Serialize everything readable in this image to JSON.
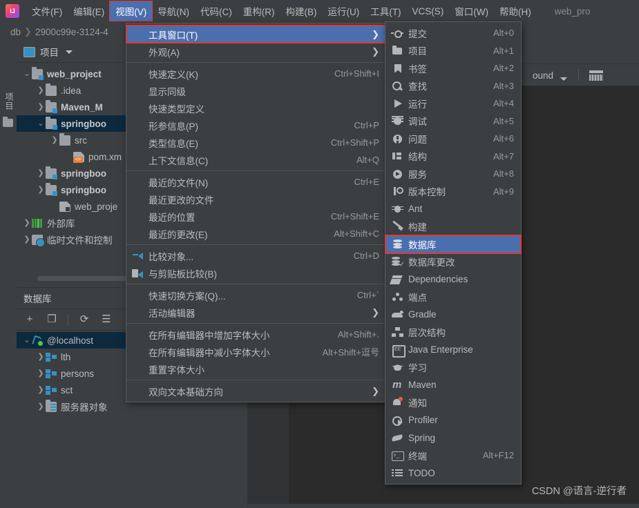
{
  "menubar": {
    "logo": "intellij-logo",
    "items": [
      {
        "label": "文件(F)",
        "active": false
      },
      {
        "label": "编辑(E)",
        "active": false
      },
      {
        "label": "视图(V)",
        "active": true
      },
      {
        "label": "导航(N)",
        "active": false
      },
      {
        "label": "代码(C)",
        "active": false
      },
      {
        "label": "重构(R)",
        "active": false
      },
      {
        "label": "构建(B)",
        "active": false
      },
      {
        "label": "运行(U)",
        "active": false
      },
      {
        "label": "工具(T)",
        "active": false
      },
      {
        "label": "VCS(S)",
        "active": false
      },
      {
        "label": "窗口(W)",
        "active": false
      },
      {
        "label": "帮助(H)",
        "active": false
      }
    ],
    "window_title": "web_pro"
  },
  "breadcrumb": {
    "root": "db",
    "separator": "❯",
    "current": "2900c99e-3124-4"
  },
  "left_strip": {
    "vertical_tab": "项目",
    "folder_icon": "folder-icon"
  },
  "project_panel": {
    "title": "项目",
    "icon": "project-window-icon",
    "chevron": "chevron-down-icon",
    "tree": [
      {
        "indent": 0,
        "arrow": "⌄",
        "icon": "module-folder-icon",
        "label": "web_project",
        "bold": true,
        "selected": false
      },
      {
        "indent": 1,
        "arrow": "❯",
        "icon": "folder-icon",
        "label": ".idea",
        "bold": false,
        "selected": false
      },
      {
        "indent": 1,
        "arrow": "❯",
        "icon": "module-folder-icon",
        "label": "Maven_M",
        "bold": true,
        "selected": false
      },
      {
        "indent": 1,
        "arrow": "⌄",
        "icon": "module-folder-icon",
        "label": "springboo",
        "bold": true,
        "selected": true
      },
      {
        "indent": 2,
        "arrow": "❯",
        "icon": "folder-icon",
        "label": "src",
        "bold": false,
        "selected": false
      },
      {
        "indent": 3,
        "arrow": "",
        "icon": "xml-file-icon",
        "label": "pom.xm",
        "bold": false,
        "selected": false
      },
      {
        "indent": 1,
        "arrow": "❯",
        "icon": "module-folder-icon",
        "label": "springboo",
        "bold": true,
        "selected": false
      },
      {
        "indent": 1,
        "arrow": "❯",
        "icon": "module-folder-icon",
        "label": "springboo",
        "bold": true,
        "selected": false
      },
      {
        "indent": 2,
        "arrow": "",
        "icon": "iml-file-icon",
        "label": "web_proje",
        "bold": false,
        "selected": false
      },
      {
        "indent": 0,
        "arrow": "❯",
        "icon": "external-library-icon",
        "label": "外部库",
        "bold": false,
        "selected": false
      },
      {
        "indent": 0,
        "arrow": "❯",
        "icon": "scratches-icon",
        "label": "临时文件和控制",
        "bold": false,
        "selected": false
      }
    ],
    "scrollbar": "horizontal-scrollbar"
  },
  "database_panel": {
    "title": "数据库",
    "toolbar": [
      {
        "name": "add-button",
        "glyph": "+"
      },
      {
        "name": "duplicate-button",
        "glyph": "❐"
      },
      {
        "name": "refresh-button",
        "glyph": "⟳"
      },
      {
        "name": "data-source-properties-button",
        "glyph": "☰"
      }
    ],
    "tree": [
      {
        "indent": 0,
        "arrow": "⌄",
        "icon": "connection-icon",
        "label": "@localhost",
        "selected": true
      },
      {
        "indent": 1,
        "arrow": "❯",
        "icon": "schema-icon",
        "label": "lth",
        "selected": false
      },
      {
        "indent": 1,
        "arrow": "❯",
        "icon": "schema-icon",
        "label": "persons",
        "selected": false
      },
      {
        "indent": 1,
        "arrow": "❯",
        "icon": "schema-icon",
        "label": "sct",
        "selected": false
      },
      {
        "indent": 1,
        "arrow": "❯",
        "icon": "server-objects-icon",
        "label": "服务器对象",
        "selected": false
      }
    ]
  },
  "editor": {
    "combo_value": "ound",
    "combo_chevron": "chevron-down-icon",
    "grid_icon": "table-grid-icon",
    "watermark": "CSDN @语言-逆行者"
  },
  "view_menu": {
    "items": [
      {
        "type": "item",
        "icon": "",
        "label": "工具窗口(T)",
        "underline": "T",
        "shortcut": "",
        "arrow": "❯",
        "highlighted": true
      },
      {
        "type": "item",
        "icon": "",
        "label": "外观(A)",
        "underline": "A",
        "shortcut": "",
        "arrow": "❯",
        "highlighted": false
      },
      {
        "type": "separator"
      },
      {
        "type": "item",
        "icon": "",
        "label": "快速定义(K)",
        "underline": "K",
        "shortcut": "Ctrl+Shift+I",
        "arrow": "",
        "highlighted": false
      },
      {
        "type": "item",
        "icon": "",
        "label": "显示同级",
        "underline": "",
        "shortcut": "",
        "arrow": "",
        "highlighted": false
      },
      {
        "type": "item",
        "icon": "",
        "label": "快速类型定义",
        "underline": "",
        "shortcut": "",
        "arrow": "",
        "highlighted": false
      },
      {
        "type": "item",
        "icon": "",
        "label": "形参信息(P)",
        "underline": "P",
        "shortcut": "Ctrl+P",
        "arrow": "",
        "highlighted": false
      },
      {
        "type": "item",
        "icon": "",
        "label": "类型信息(E)",
        "underline": "E",
        "shortcut": "Ctrl+Shift+P",
        "arrow": "",
        "highlighted": false
      },
      {
        "type": "item",
        "icon": "",
        "label": "上下文信息(C)",
        "underline": "C",
        "shortcut": "Alt+Q",
        "arrow": "",
        "highlighted": false
      },
      {
        "type": "separator"
      },
      {
        "type": "item",
        "icon": "",
        "label": "最近的文件(N)",
        "underline": "N",
        "shortcut": "Ctrl+E",
        "arrow": "",
        "highlighted": false
      },
      {
        "type": "item",
        "icon": "",
        "label": "最近更改的文件",
        "underline": "",
        "shortcut": "",
        "arrow": "",
        "highlighted": false
      },
      {
        "type": "item",
        "icon": "",
        "label": "最近的位置",
        "underline": "",
        "shortcut": "Ctrl+Shift+E",
        "arrow": "",
        "highlighted": false
      },
      {
        "type": "item",
        "icon": "",
        "label": "最近的更改(E)",
        "underline": "E",
        "shortcut": "Alt+Shift+C",
        "arrow": "",
        "highlighted": false
      },
      {
        "type": "separator"
      },
      {
        "type": "item",
        "icon": "diff-icon",
        "label": "比较对象...",
        "underline": "",
        "shortcut": "Ctrl+D",
        "arrow": "",
        "highlighted": false
      },
      {
        "type": "item",
        "icon": "clipboard-diff-icon",
        "label": "与剪贴板比较(B)",
        "underline": "B",
        "shortcut": "",
        "arrow": "",
        "highlighted": false
      },
      {
        "type": "separator"
      },
      {
        "type": "item",
        "icon": "",
        "label": "快速切换方案(Q)...",
        "underline": "Q",
        "shortcut": "Ctrl+`",
        "arrow": "",
        "highlighted": false
      },
      {
        "type": "item",
        "icon": "",
        "label": "活动编辑器",
        "underline": "",
        "shortcut": "",
        "arrow": "❯",
        "highlighted": false
      },
      {
        "type": "separator"
      },
      {
        "type": "item",
        "icon": "",
        "label": "在所有编辑器中增加字体大小",
        "underline": "",
        "shortcut": "Alt+Shift+.",
        "arrow": "",
        "highlighted": false
      },
      {
        "type": "item",
        "icon": "",
        "label": "在所有编辑器中减小字体大小",
        "underline": "",
        "shortcut": "Alt+Shift+逗号",
        "arrow": "",
        "highlighted": false
      },
      {
        "type": "item",
        "icon": "",
        "label": "重置字体大小",
        "underline": "",
        "shortcut": "",
        "arrow": "",
        "highlighted": false
      },
      {
        "type": "separator"
      },
      {
        "type": "item",
        "icon": "",
        "label": "双向文本基础方向",
        "underline": "",
        "shortcut": "",
        "arrow": "❯",
        "highlighted": false
      }
    ]
  },
  "tool_windows_submenu": {
    "items": [
      {
        "icon": "commit-icon",
        "icon_class": "i-commit",
        "label": "提交",
        "shortcut": "Alt+0",
        "highlighted": false
      },
      {
        "icon": "project-icon",
        "icon_class": "i-project",
        "label": "项目",
        "shortcut": "Alt+1",
        "highlighted": false
      },
      {
        "icon": "bookmark-icon",
        "icon_class": "i-bookmark",
        "label": "书签",
        "shortcut": "Alt+2",
        "highlighted": false
      },
      {
        "icon": "search-icon",
        "icon_class": "i-find",
        "label": "查找",
        "shortcut": "Alt+3",
        "highlighted": false
      },
      {
        "icon": "run-icon",
        "icon_class": "i-run",
        "label": "运行",
        "shortcut": "Alt+4",
        "highlighted": false
      },
      {
        "icon": "debug-bug-icon",
        "icon_class": "i-debug",
        "label": "调试",
        "shortcut": "Alt+5",
        "highlighted": false
      },
      {
        "icon": "problem-icon",
        "icon_class": "i-problem",
        "label": "问题",
        "shortcut": "Alt+6",
        "highlighted": false
      },
      {
        "icon": "structure-icon",
        "icon_class": "i-structure",
        "label": "结构",
        "shortcut": "Alt+7",
        "highlighted": false
      },
      {
        "icon": "services-icon",
        "icon_class": "i-services",
        "label": "服务",
        "shortcut": "Alt+8",
        "highlighted": false
      },
      {
        "icon": "version-control-icon",
        "icon_class": "i-vcs",
        "label": "版本控制",
        "shortcut": "Alt+9",
        "highlighted": false
      },
      {
        "icon": "ant-icon",
        "icon_class": "i-ant",
        "label": "Ant",
        "shortcut": "",
        "highlighted": false
      },
      {
        "icon": "build-hammer-icon",
        "icon_class": "i-build",
        "label": "构建",
        "shortcut": "",
        "highlighted": false
      },
      {
        "icon": "database-icon",
        "icon_class": "i-db",
        "label": "数据库",
        "shortcut": "",
        "highlighted": true
      },
      {
        "icon": "database-changes-icon",
        "icon_class": "i-dbchange",
        "label": "数据库更改",
        "shortcut": "",
        "highlighted": false
      },
      {
        "icon": "dependencies-icon",
        "icon_class": "i-deps",
        "label": "Dependencies",
        "shortcut": "",
        "highlighted": false
      },
      {
        "icon": "endpoints-icon",
        "icon_class": "i-endpoint",
        "label": "端点",
        "shortcut": "",
        "highlighted": false
      },
      {
        "icon": "gradle-elephant-icon",
        "icon_class": "i-gradle",
        "label": "Gradle",
        "shortcut": "",
        "highlighted": false
      },
      {
        "icon": "hierarchy-icon",
        "icon_class": "i-hierarchy",
        "label": "层次结构",
        "shortcut": "",
        "highlighted": false
      },
      {
        "icon": "java-enterprise-icon",
        "icon_class": "i-javaee",
        "label": "Java Enterprise",
        "shortcut": "",
        "highlighted": false
      },
      {
        "icon": "learn-graduation-icon",
        "icon_class": "i-learn",
        "label": "学习",
        "shortcut": "",
        "highlighted": false
      },
      {
        "icon": "maven-icon",
        "icon_class": "i-maven",
        "label": "Maven",
        "shortcut": "",
        "highlighted": false
      },
      {
        "icon": "notification-bell-icon",
        "icon_class": "i-notify",
        "label": "通知",
        "shortcut": "",
        "highlighted": false
      },
      {
        "icon": "profiler-icon",
        "icon_class": "i-profiler",
        "label": "Profiler",
        "shortcut": "",
        "highlighted": false
      },
      {
        "icon": "spring-leaf-icon",
        "icon_class": "i-spring",
        "label": "Spring",
        "shortcut": "",
        "highlighted": false
      },
      {
        "icon": "terminal-icon",
        "icon_class": "i-terminal",
        "label": "终端",
        "shortcut": "Alt+F12",
        "highlighted": false
      },
      {
        "icon": "todo-list-icon",
        "icon_class": "i-todo",
        "label": "TODO",
        "shortcut": "",
        "highlighted": false
      }
    ]
  },
  "colors": {
    "background": "#3c3f41",
    "editor_background": "#2b2b2b",
    "menu_highlight": "#4b6eaf",
    "highlight_border": "#e03a32",
    "tree_selected": "#0d293e",
    "accent_blue": "#3592c4",
    "text": "#bbbbbb"
  }
}
